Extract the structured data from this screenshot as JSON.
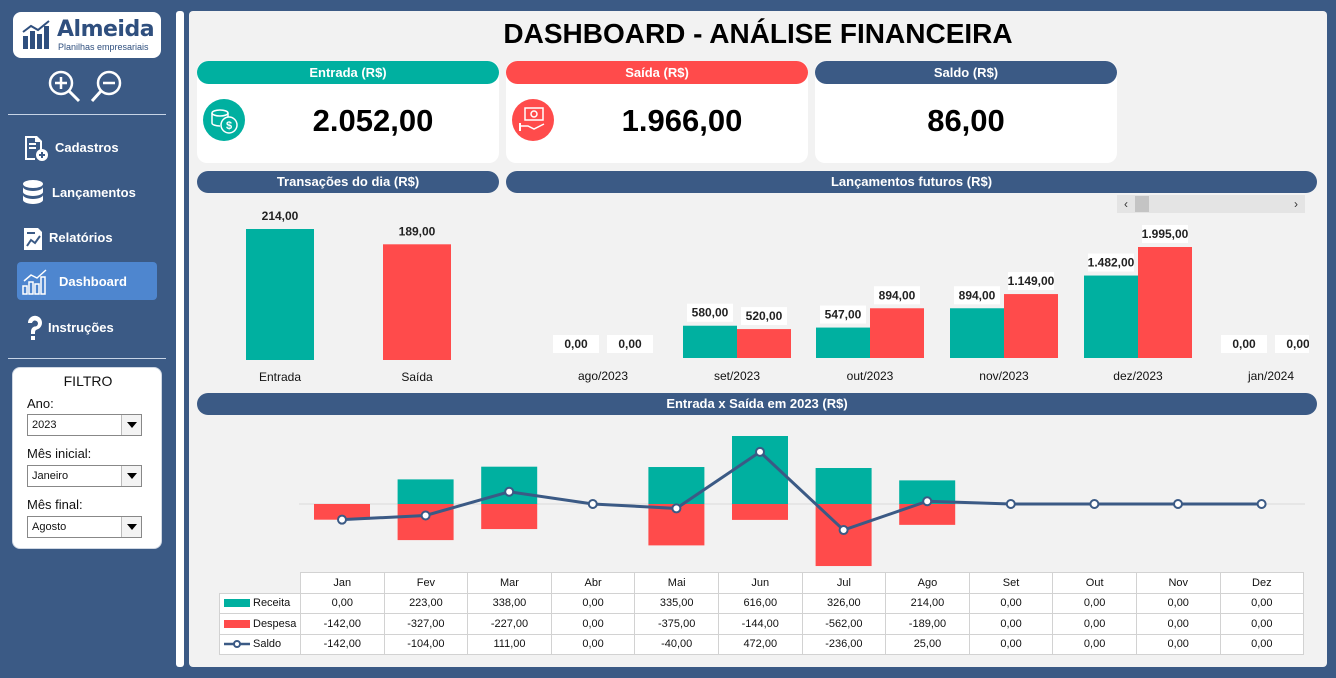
{
  "brand": {
    "name": "Almeida",
    "subtitle": "Planilhas empresariais"
  },
  "sidebar": {
    "zoom_in_icon": "zoom-in-icon",
    "zoom_out_icon": "zoom-out-icon",
    "items": [
      {
        "label": "Cadastros",
        "icon": "register-icon",
        "active": false
      },
      {
        "label": "Lançamentos",
        "icon": "database-icon",
        "active": false
      },
      {
        "label": "Relatórios",
        "icon": "report-icon",
        "active": false
      },
      {
        "label": "Dashboard",
        "icon": "dashboard-icon",
        "active": true
      },
      {
        "label": "Instruções",
        "icon": "question-icon",
        "active": false
      }
    ]
  },
  "filter": {
    "title": "FILTRO",
    "ano_label": "Ano:",
    "ano_value": "2023",
    "mes_inicial_label": "Mês inicial:",
    "mes_inicial_value": "Janeiro",
    "mes_final_label": "Mês final:",
    "mes_final_value": "Agosto"
  },
  "title": "DASHBOARD - ANÁLISE FINANCEIRA",
  "kpis": {
    "entrada": {
      "label": "Entrada (R$)",
      "value": "2.052,00",
      "color": "#00b0a0"
    },
    "saida": {
      "label": "Saída (R$)",
      "value": "1.966,00",
      "color": "#ff4b4b"
    },
    "saldo": {
      "label": "Saldo (R$)",
      "value": "86,00",
      "color": "#3b5a85"
    }
  },
  "sections": {
    "transacoes": "Transações do dia (R$)",
    "futuros": "Lançamentos futuros (R$)",
    "anual": "Entrada x Saída em 2023 (R$)"
  },
  "colors": {
    "receita": "#00b0a0",
    "despesa": "#ff4b4b",
    "saldo": "#3b5a85"
  },
  "chart_data": [
    {
      "type": "bar",
      "categories": [
        "Entrada",
        "Saída"
      ],
      "values": [
        214,
        189
      ],
      "labels": [
        "214,00",
        "189,00"
      ]
    },
    {
      "type": "bar",
      "categories": [
        "ago/2023",
        "set/2023",
        "out/2023",
        "nov/2023",
        "dez/2023",
        "jan/2024"
      ],
      "series": [
        {
          "values": [
            0,
            580,
            547,
            894,
            1482,
            0
          ],
          "labels": [
            "0,00",
            "580,00",
            "547,00",
            "894,00",
            "1.482,00",
            "0,00"
          ]
        },
        {
          "values": [
            0,
            520,
            894,
            1149,
            1995,
            0
          ],
          "labels": [
            "0,00",
            "520,00",
            "894,00",
            "1.149,00",
            "1.995,00",
            "0,00"
          ]
        }
      ]
    },
    {
      "type": "bar",
      "categories": [
        "Jan",
        "Fev",
        "Mar",
        "Abr",
        "Mai",
        "Jun",
        "Jul",
        "Ago",
        "Set",
        "Out",
        "Nov",
        "Dez"
      ],
      "series": [
        {
          "name": "Receita",
          "values": [
            0,
            223,
            338,
            0,
            335,
            616,
            326,
            214,
            0,
            0,
            0,
            0
          ],
          "labels": [
            "0,00",
            "223,00",
            "338,00",
            "0,00",
            "335,00",
            "616,00",
            "326,00",
            "214,00",
            "0,00",
            "0,00",
            "0,00",
            "0,00"
          ]
        },
        {
          "name": "Despesa",
          "values": [
            -142,
            -327,
            -227,
            0,
            -375,
            -144,
            -562,
            -189,
            0,
            0,
            0,
            0
          ],
          "labels": [
            "-142,00",
            "-327,00",
            "-227,00",
            "0,00",
            "-375,00",
            "-144,00",
            "-562,00",
            "-189,00",
            "0,00",
            "0,00",
            "0,00",
            "0,00"
          ]
        },
        {
          "name": "Saldo",
          "type": "line",
          "values": [
            -142,
            -104,
            111,
            0,
            -40,
            472,
            -236,
            25,
            0,
            0,
            0,
            0
          ],
          "labels": [
            "-142,00",
            "-104,00",
            "111,00",
            "0,00",
            "-40,00",
            "472,00",
            "-236,00",
            "25,00",
            "0,00",
            "0,00",
            "0,00",
            "0,00"
          ]
        }
      ]
    }
  ]
}
